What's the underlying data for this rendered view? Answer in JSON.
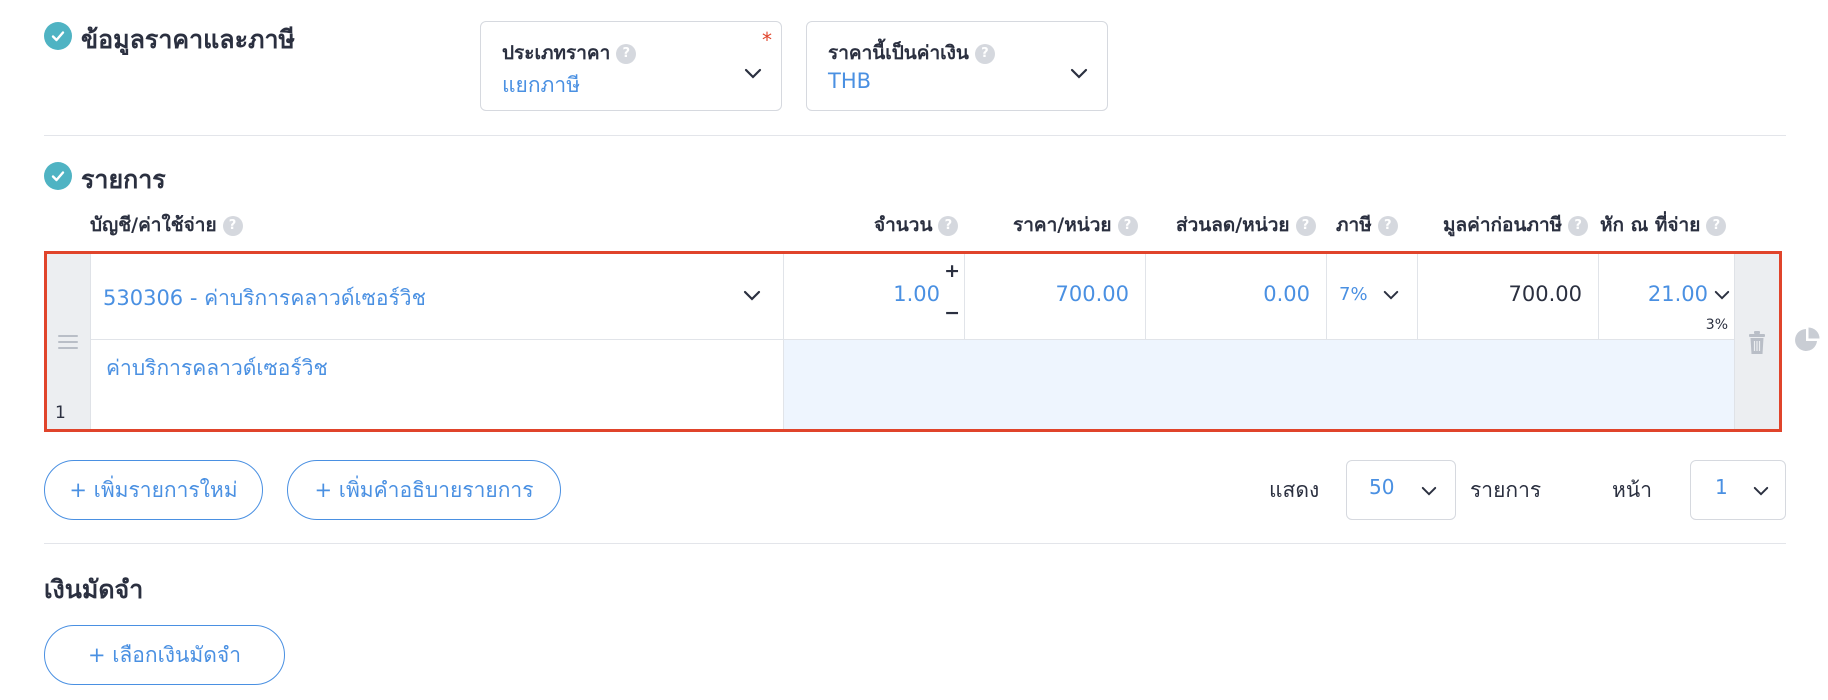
{
  "tax_section": {
    "title": "ข้อมูลราคาและภาษี",
    "price_type": {
      "label": "ประเภทราคา",
      "required_mark": "*",
      "value": "แยกภาษี"
    },
    "currency": {
      "label": "ราคานี้เป็นค่าเงิน",
      "value": "THB"
    }
  },
  "items_section": {
    "title": "รายการ",
    "columns": {
      "account": "บัญชี/ค่าใช้จ่าย",
      "quantity": "จำนวน",
      "unit_price": "ราคา/หน่วย",
      "discount": "ส่วนลด/หน่วย",
      "tax": "ภาษี",
      "pre_tax": "มูลค่าก่อนภาษี",
      "withholding": "หัก ณ ที่จ่าย"
    },
    "help_glyph": "?",
    "row": {
      "number": "1",
      "account": "530306 - ค่าบริการคลาวด์เซอร์วิช",
      "quantity": "1.00",
      "plus": "+",
      "minus": "−",
      "unit_price": "700.00",
      "discount": "0.00",
      "tax": "7%",
      "pre_tax": "700.00",
      "withholding": "21.00",
      "withholding_rate": "3%",
      "description": "ค่าบริการคลาวด์เซอร์วิช"
    },
    "add_item_button": "+ เพิ่มรายการใหม่",
    "add_description_button": "+ เพิ่มคำอธิบายรายการ",
    "pagination": {
      "show_label": "แสดง",
      "per_page": "50",
      "items_label": "รายการ",
      "page_label": "หน้า",
      "page": "1"
    }
  },
  "deposit_section": {
    "title": "เงินมัดจำ",
    "select_button": "+ เลือกเงินมัดจำ"
  },
  "colors": {
    "accent": "#4a90e2",
    "check": "#4fb3c3",
    "highlight_border": "#e0442b",
    "description_fill": "#eef5fe"
  }
}
